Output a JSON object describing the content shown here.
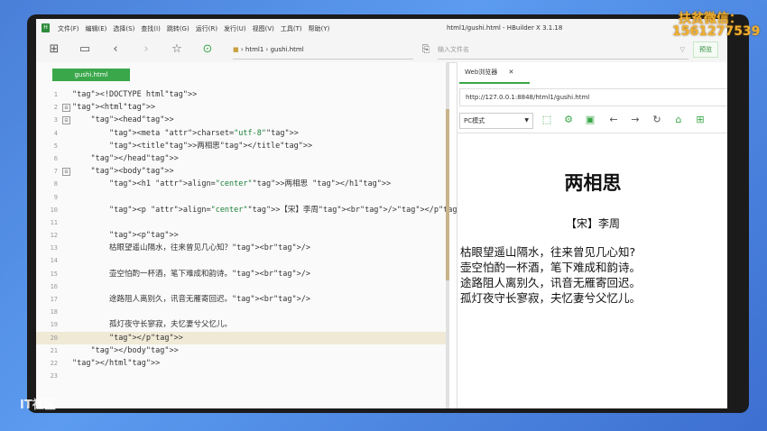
{
  "menubar": {
    "items": [
      "文件(F)",
      "编辑(E)",
      "选择(S)",
      "查找(I)",
      "跳转(G)",
      "运行(R)",
      "发行(U)",
      "视图(V)",
      "工具(T)",
      "帮助(Y)"
    ],
    "window_title": "html1/gushi.html - HBuilder X 3.1.18"
  },
  "toolbar": {
    "breadcrumb": [
      "html1",
      "gushi.html"
    ],
    "search_placeholder": "输入文件名",
    "preview_label": "预览"
  },
  "editor": {
    "tab_label": "gushi.html",
    "lines": [
      {
        "n": "1",
        "fold": "",
        "text": "<!DOCTYPE html>"
      },
      {
        "n": "2",
        "fold": "⊟",
        "text": "<html>"
      },
      {
        "n": "3",
        "fold": "⊟",
        "text": "    <head>"
      },
      {
        "n": "4",
        "fold": "",
        "text": "        <meta charset=\"utf-8\">"
      },
      {
        "n": "5",
        "fold": "",
        "text": "        <title>两相思</title>"
      },
      {
        "n": "6",
        "fold": "",
        "text": "    </head>"
      },
      {
        "n": "7",
        "fold": "⊟",
        "text": "    <body>"
      },
      {
        "n": "8",
        "fold": "",
        "text": "        <h1 align=\"center\">两相思 </h1>"
      },
      {
        "n": "9",
        "fold": "",
        "text": ""
      },
      {
        "n": "10",
        "fold": "",
        "text": "        <p align=\"center\">【宋】李周<br/></p>"
      },
      {
        "n": "11",
        "fold": "",
        "text": ""
      },
      {
        "n": "12",
        "fold": "",
        "text": "        <p>"
      },
      {
        "n": "13",
        "fold": "",
        "text": "        枯眼望遥山隔水，往来曾见几心知？<br/>"
      },
      {
        "n": "14",
        "fold": "",
        "text": ""
      },
      {
        "n": "15",
        "fold": "",
        "text": "        壶空怕酌一杯酒，笔下难成和韵诗。<br/>"
      },
      {
        "n": "16",
        "fold": "",
        "text": ""
      },
      {
        "n": "17",
        "fold": "",
        "text": "        途路阻人离别久，讯音无雁寄回迟。<br/>"
      },
      {
        "n": "18",
        "fold": "",
        "text": ""
      },
      {
        "n": "19",
        "fold": "",
        "text": "        孤灯夜守长寥寂，夫忆妻兮父忆儿。"
      },
      {
        "n": "20",
        "fold": "",
        "text": "        </p>"
      },
      {
        "n": "21",
        "fold": "",
        "text": "    </body>"
      },
      {
        "n": "22",
        "fold": "",
        "text": "</html>"
      },
      {
        "n": "23",
        "fold": "",
        "text": ""
      }
    ]
  },
  "browser": {
    "tab_label": "Web浏览器",
    "url": "http://127.0.0.1:8848/html1/gushi.html",
    "mode": "PC模式",
    "page": {
      "h1": "两相思",
      "author": "【宋】李周",
      "poem": [
        "枯眼望遥山隔水，往来曾见几心知?",
        "壶空怕酌一杯酒，笔下难成和韵诗。",
        "途路阻人离别久，讯音无雁寄回迟。",
        "孤灯夜守长寥寂，夫忆妻兮父忆儿。"
      ]
    }
  },
  "watermark": {
    "line1": "扶贫微信：",
    "line2": "1561277539",
    "line3": "IT社区"
  },
  "colors": {
    "accent_green": "#3aa74a",
    "tag_blue": "#0033b3",
    "attr_brown": "#a0522d",
    "string_green": "#1a7f37"
  }
}
